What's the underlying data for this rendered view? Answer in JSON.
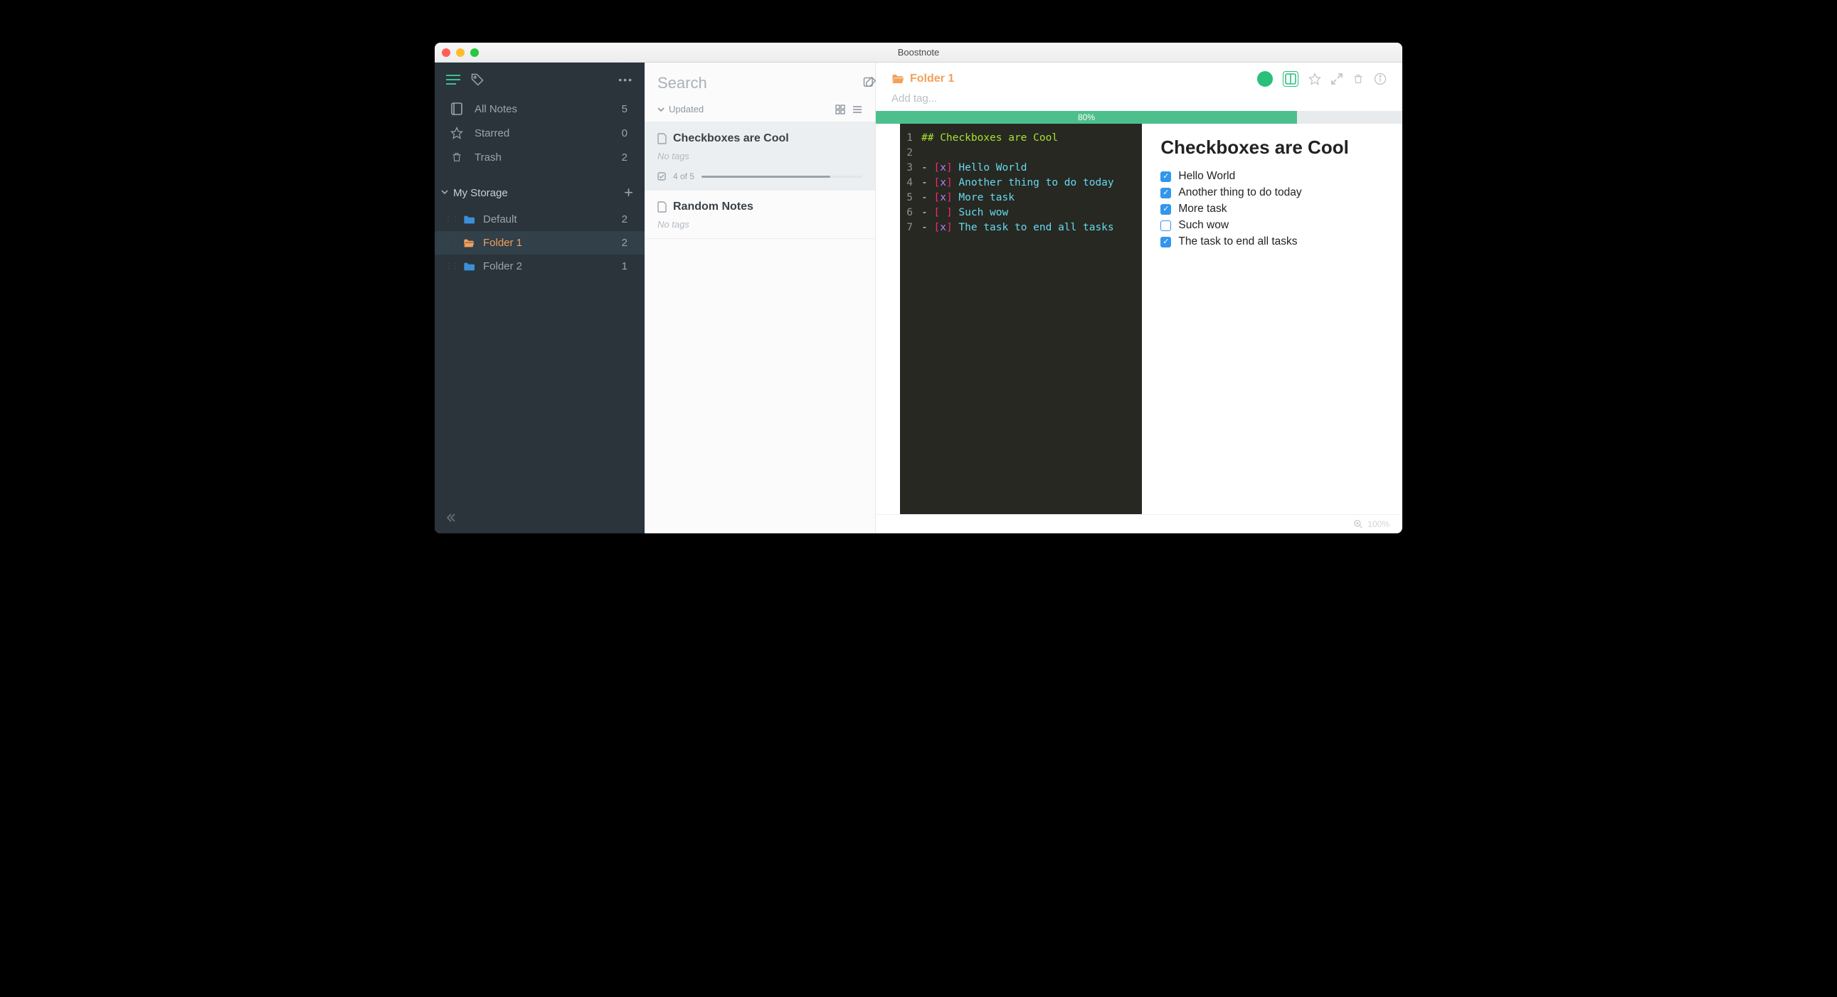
{
  "window": {
    "title": "Boostnote"
  },
  "sidebar": {
    "nav": [
      {
        "icon": "notebook",
        "label": "All Notes",
        "count": "5"
      },
      {
        "icon": "star",
        "label": "Starred",
        "count": "0"
      },
      {
        "icon": "trash",
        "label": "Trash",
        "count": "2"
      }
    ],
    "storage_label": "My Storage",
    "folders": [
      {
        "label": "Default",
        "count": "2",
        "color": "blue",
        "selected": false
      },
      {
        "label": "Folder 1",
        "count": "2",
        "color": "orange",
        "selected": true
      },
      {
        "label": "Folder 2",
        "count": "1",
        "color": "blue",
        "selected": false
      }
    ]
  },
  "list": {
    "search_placeholder": "Search",
    "sort_label": "Updated",
    "notes": [
      {
        "title": "Checkboxes are Cool",
        "tags_label": "No tags",
        "progress_label": "4 of 5",
        "progress_pct": 80,
        "selected": true
      },
      {
        "title": "Random Notes",
        "tags_label": "No tags",
        "selected": false
      }
    ]
  },
  "editor": {
    "breadcrumb_label": "Folder 1",
    "tag_placeholder": "Add tag...",
    "progress_pct": 80,
    "progress_text": "80%",
    "code_lines": [
      {
        "n": "1",
        "segments": [
          {
            "c": "tok-header",
            "t": "## Checkboxes are Cool"
          }
        ]
      },
      {
        "n": "2",
        "segments": []
      },
      {
        "n": "3",
        "segments": [
          {
            "c": "tok-bullet",
            "t": "- "
          },
          {
            "c": "tok-bracket",
            "t": "["
          },
          {
            "c": "tok-xmark",
            "t": "x"
          },
          {
            "c": "tok-bracket",
            "t": "]"
          },
          {
            "c": "tok-text",
            "t": " Hello World"
          }
        ]
      },
      {
        "n": "4",
        "segments": [
          {
            "c": "tok-bullet",
            "t": "- "
          },
          {
            "c": "tok-bracket",
            "t": "["
          },
          {
            "c": "tok-xmark",
            "t": "x"
          },
          {
            "c": "tok-bracket",
            "t": "]"
          },
          {
            "c": "tok-text",
            "t": " Another thing to do today"
          }
        ]
      },
      {
        "n": "5",
        "segments": [
          {
            "c": "tok-bullet",
            "t": "- "
          },
          {
            "c": "tok-bracket",
            "t": "["
          },
          {
            "c": "tok-xmark",
            "t": "x"
          },
          {
            "c": "tok-bracket",
            "t": "]"
          },
          {
            "c": "tok-text",
            "t": " More task"
          }
        ]
      },
      {
        "n": "6",
        "segments": [
          {
            "c": "tok-bullet",
            "t": "- "
          },
          {
            "c": "tok-bracket",
            "t": "["
          },
          {
            "c": "tok-xmark",
            "t": " "
          },
          {
            "c": "tok-bracket",
            "t": "]"
          },
          {
            "c": "tok-text",
            "t": " Such wow"
          }
        ]
      },
      {
        "n": "7",
        "segments": [
          {
            "c": "tok-bullet",
            "t": "- "
          },
          {
            "c": "tok-bracket",
            "t": "["
          },
          {
            "c": "tok-xmark",
            "t": "x"
          },
          {
            "c": "tok-bracket",
            "t": "]"
          },
          {
            "c": "tok-text",
            "t": " The task to end all tasks"
          }
        ]
      }
    ],
    "preview_title": "Checkboxes are Cool",
    "tasks": [
      {
        "label": "Hello World",
        "checked": true
      },
      {
        "label": "Another thing to do today",
        "checked": true
      },
      {
        "label": "More task",
        "checked": true
      },
      {
        "label": "Such wow",
        "checked": false
      },
      {
        "label": "The task to end all tasks",
        "checked": true
      }
    ],
    "zoom_label": "100%"
  }
}
